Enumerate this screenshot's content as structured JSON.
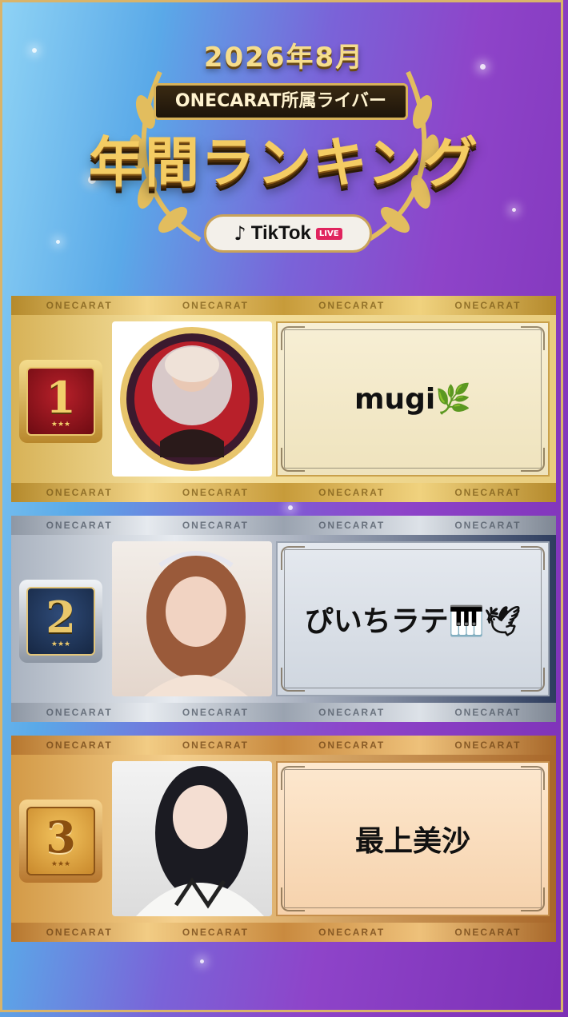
{
  "header": {
    "date": "2026年8月",
    "subtitle": "ONECARAT所属ライバー",
    "title": "年間ランキング",
    "platform": "TikTok",
    "live_tag": "LIVE"
  },
  "brand_bar_text": "ONECARAT",
  "rankings": [
    {
      "rank": "1",
      "name": "mugi🌿",
      "stars": "★★★",
      "tier": "gold"
    },
    {
      "rank": "2",
      "name": "ぴいちラテ🎹🕊",
      "stars": "★★★",
      "tier": "silver"
    },
    {
      "rank": "3",
      "name": "最上美沙",
      "stars": "★★★",
      "tier": "bronze"
    }
  ],
  "colors": {
    "gold": "#d7b257",
    "silver": "#aab3c0",
    "bronze": "#d39a47",
    "frame": "#d9b46a"
  }
}
